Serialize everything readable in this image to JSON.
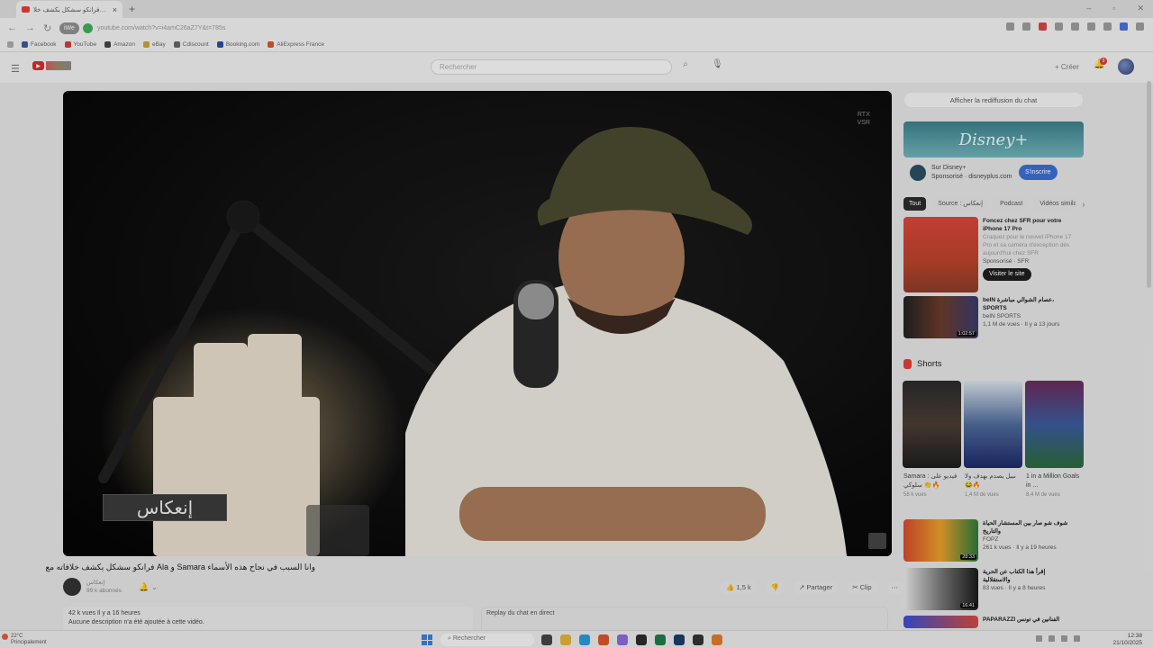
{
  "browser": {
    "tab_title": "فرانكو سشكل يكشف خلا…",
    "url": "youtube.com/watch?v=i4amC26aZ7Y&t=785s",
    "pill_label": "iWe",
    "bookmarks": [
      "Facebook",
      "YouTube",
      "Amazon",
      "eBay",
      "Cdiscount",
      "Booking.com",
      "AliExpress France"
    ]
  },
  "youtube": {
    "search_placeholder": "Rechercher",
    "create_label": "Créer",
    "notif_count": "9"
  },
  "video": {
    "corner_tag": "RTX\nVSR",
    "overlay_logo": "إنعكاس",
    "title": "وانا السبب في نجاح هذه الأسماء Samara و Ala فرانكو سشكل يكشف خلافاته مع",
    "channel_name": "إنعكاس",
    "channel_subs": "99 k abonnés",
    "likes": "1,5 k",
    "share": "Partager",
    "clip": "Clip",
    "views_date": "42 k vues  Il y a 16 heures",
    "description": "Aucune description n'a été ajoutée à cette vidéo.",
    "chat_replay": "Replay du chat en direct"
  },
  "sidebar": {
    "chat_button": "Afficher la rediffusion du chat",
    "ad_brand": "Disney+",
    "ad_name": "Sur Disney+",
    "ad_sponsor": "Sponsorisé · disneyplus.com",
    "subscribe": "S'inscrire",
    "chips": [
      "Tout",
      "Source : إنعكاس",
      "Podcast",
      "Vidéos similaires"
    ],
    "ad_card": {
      "title": "Foncez chez SFR pour votre iPhone 17 Pro",
      "text": "Craquez pour le nouvel iPhone 17 Pro et sa caméra d'exception dès aujourd'hui chez SFR",
      "sponsor": "Sponsorisé · SFR",
      "cta": "Visiter le site"
    },
    "video_card": {
      "title": "beIN عصام الشوالي مباشرة، SPORTS",
      "channel": "beIN SPORTS",
      "meta": "1,1 M de vues · Il y a 13 jours",
      "duration": "1:02:57"
    },
    "shorts_title": "Shorts",
    "shorts": [
      {
        "title": "Samara : فيديو على سلوكي 👏🔥",
        "views": "58 k vues"
      },
      {
        "title": "نبيل يصدم بهدف ولا 😂🔥",
        "views": "1,4 M de vues"
      },
      {
        "title": "1 in a Million Goals in ...",
        "views": "8,4 M de vues"
      }
    ],
    "next_card": {
      "title": "شوف شو صار بين المستشار الحياة والتاريخ",
      "channel": "FOPZ",
      "meta": "261 k vues · Il y a 19 heures",
      "duration": "28:33"
    },
    "next_card2": {
      "title": "إقرأ هذا الكتاب عن الحرية والاستقلالية",
      "meta": "83 vues · Il y a 8 heures",
      "duration": "16:41"
    },
    "next_card3": {
      "title": "PAPARAZZI الفنانين في تونس"
    }
  },
  "taskbar": {
    "weather_temp": "22°C",
    "weather_text": "Principalement",
    "search": "Rechercher",
    "time": "12:38",
    "date": "21/10/2025"
  }
}
